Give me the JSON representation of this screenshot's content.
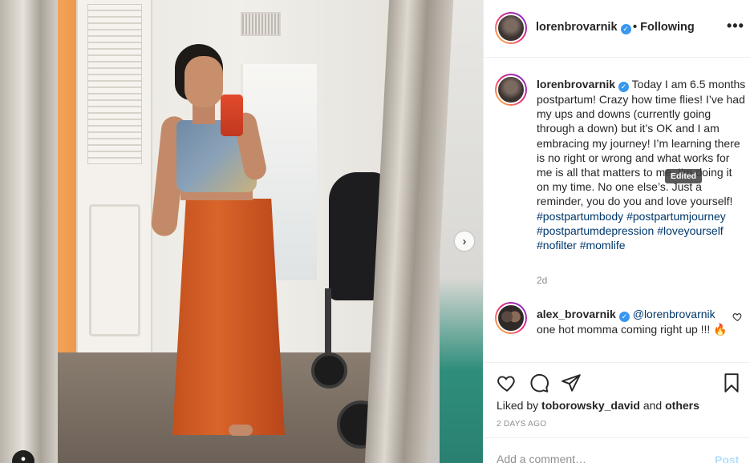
{
  "post": {
    "author": "lorenbrovarnik",
    "follow_status": "• Following",
    "more_icon": "more-horizontal-icon",
    "caption_text": "Today I am 6.5 months postpartum! Crazy how time flies! I’ve had my ups and downs (currently going through a down) but it’s OK and I am embracing my journey! I’m learning there is no right or wrong and what works for me is all that matters to me. I’m doing it on my time. No one else’s. Just a reminder, you do you and love yourself!",
    "hashtags": "#postpartumbody #postpartumjourney #postpartumdepression #loveyourself #nofilter #momlife",
    "age": "2d",
    "edited_tooltip": "Edited"
  },
  "comment": {
    "author": "alex_brovarnik",
    "mention": "@lorenbrovarnik",
    "text": "one hot momma coming right up !!! 🔥"
  },
  "actions": {
    "liked_by_prefix": "Liked by",
    "liked_by_user": "toborowsky_david",
    "liked_by_and": "and",
    "liked_by_others": "others",
    "timestamp": "2 DAYS AGO"
  },
  "add_comment": {
    "placeholder": "Add a comment…",
    "post_label": "Post"
  },
  "colors": {
    "link": "#00376b",
    "verified": "#3897f0",
    "post_disabled": "#b2dffc",
    "muted": "#8e8e8e"
  }
}
